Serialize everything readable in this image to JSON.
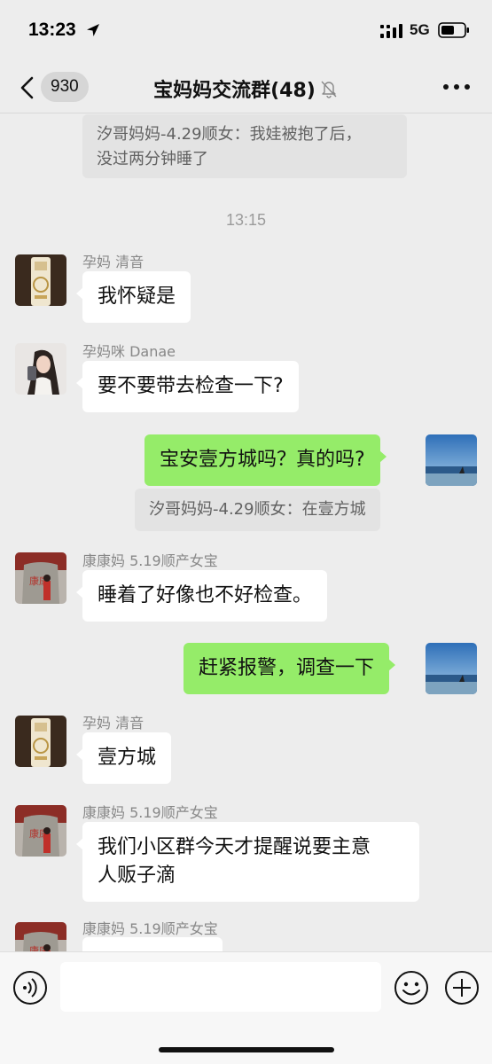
{
  "status_bar": {
    "time": "13:23",
    "network": "5G"
  },
  "nav": {
    "unread_count": "930",
    "title": "宝妈妈交流群(48)"
  },
  "messages": {
    "quote_1": "汐哥妈妈-4.29顺女：我娃被抱了后，\n没过两分钟睡了",
    "time_divider": "13:15",
    "m1_sender": "孕妈 清音",
    "m1_text": "我怀疑是",
    "m2_sender": "孕妈咪 Danae",
    "m2_text": "要不要带去检查一下?",
    "m3_text": "宝安壹方城吗？真的吗?",
    "quote_2": "汐哥妈妈-4.29顺女：在壹方城",
    "m4_sender": "康康妈 5.19顺产女宝",
    "m4_text": "睡着了好像也不好检查。",
    "m5_text": "赶紧报警，调查一下",
    "m6_sender": "孕妈 清音",
    "m6_text": "壹方城",
    "m7_sender": "康康妈 5.19顺产女宝",
    "m7_text": "我们小区群今天才提醒说要主意\n人贩子滴",
    "m8_sender": "康康妈 5.19顺产女宝"
  },
  "colors": {
    "background": "#ededed",
    "outgoing_bubble": "#95ec69",
    "incoming_bubble": "#ffffff"
  },
  "icons": [
    "location-arrow-icon",
    "signal-icon",
    "battery-icon",
    "chevron-left-icon",
    "mute-bell-icon",
    "more-icon",
    "voice-icon",
    "emoji-icon",
    "plus-icon"
  ]
}
